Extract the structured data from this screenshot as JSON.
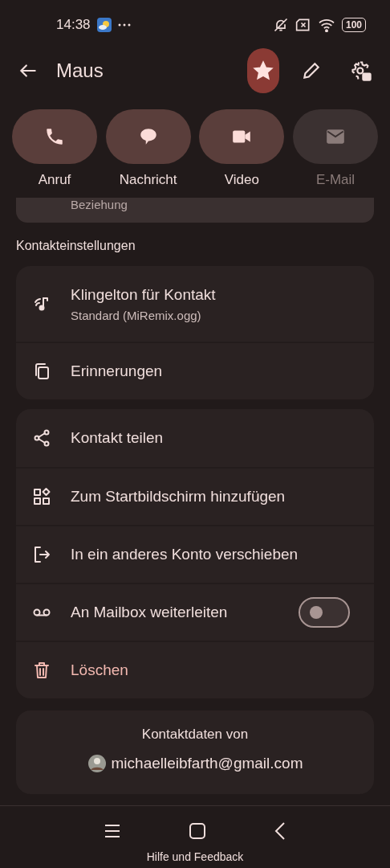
{
  "status_bar": {
    "time": "14:38",
    "battery": "100"
  },
  "header": {
    "title": "Maus",
    "starred": true
  },
  "actions": [
    {
      "label": "Anruf",
      "disabled": false
    },
    {
      "label": "Nachricht",
      "disabled": false
    },
    {
      "label": "Video",
      "disabled": false
    },
    {
      "label": "E-Mail",
      "disabled": true
    }
  ],
  "partial_card": {
    "text": "Beziehung"
  },
  "section_title": "Kontakteinstellungen",
  "groups": [
    {
      "items": [
        {
          "kind": "plain",
          "label": "Klingelton für Kontakt",
          "subtitle": "Standard (MiRemix.ogg)"
        },
        {
          "kind": "plain",
          "label": "Erinnerungen"
        }
      ]
    },
    {
      "items": [
        {
          "kind": "plain",
          "label": "Kontakt teilen"
        },
        {
          "kind": "plain",
          "label": "Zum Startbildschirm hinzufügen"
        },
        {
          "kind": "plain",
          "label": "In ein anderes Konto verschieben"
        },
        {
          "kind": "toggle",
          "label": "An Mailbox weiterleiten",
          "on": false
        },
        {
          "kind": "danger",
          "label": "Löschen"
        }
      ]
    }
  ],
  "account": {
    "title": "Kontaktdaten von",
    "email": "michaelleibfarth@gmail.com"
  },
  "footer_link": "Hilfe und Feedback"
}
